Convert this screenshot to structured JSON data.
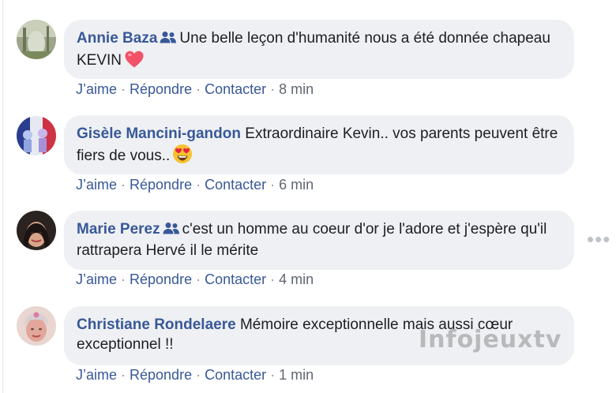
{
  "comments": [
    {
      "author": "Annie Baza",
      "has_group_icon": true,
      "text": "Une belle leçon d'humanité nous a été donnée chapeau KEVIN",
      "emoji": "heart",
      "actions": {
        "like": "J’aime",
        "reply": "Répondre",
        "contact": "Contacter",
        "time": "8 min"
      }
    },
    {
      "author": "Gisèle Mancini-gandon",
      "has_group_icon": false,
      "text": "Extraordinaire Kevin.. vos parents peuvent être fiers de vous..",
      "emoji": "heart-eyes",
      "actions": {
        "like": "J’aime",
        "reply": "Répondre",
        "contact": "Contacter",
        "time": "6 min"
      }
    },
    {
      "author": "Marie Perez",
      "has_group_icon": true,
      "text": "c'est un homme au coeur d'or je l'adore et j'espère qu'il rattrapera Hervé il le mérite",
      "emoji": "",
      "actions": {
        "like": "J’aime",
        "reply": "Répondre",
        "contact": "Contacter",
        "time": "4 min"
      }
    },
    {
      "author": "Christiane Rondelaere",
      "has_group_icon": false,
      "text": "Mémoire exceptionnelle mais aussi cœur exceptionnel !!",
      "emoji": "",
      "actions": {
        "like": "J’aime",
        "reply": "Répondre",
        "contact": "Contacter",
        "time": "1 min"
      }
    }
  ],
  "separator": "·",
  "more_options": "•••",
  "watermark": "Infojeuxtv",
  "colors": {
    "author": "#385898",
    "bubble": "#eef0f3",
    "text": "#1c1e21",
    "action_link": "#385898",
    "timestamp": "#606770"
  },
  "icons": {
    "group": "group-members-icon",
    "heart": "heart-emoji-icon",
    "heart_eyes": "heart-eyes-emoji-icon",
    "more": "more-options-icon"
  }
}
